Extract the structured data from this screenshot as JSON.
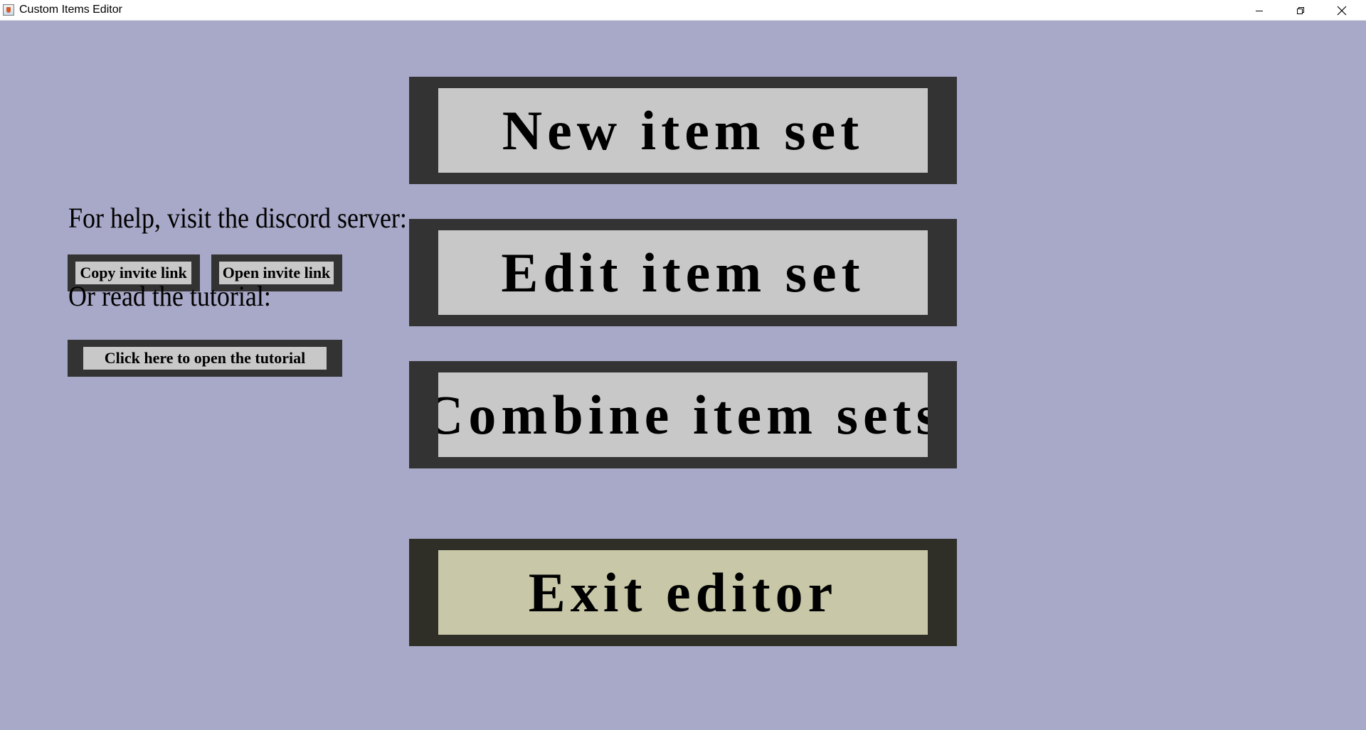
{
  "window": {
    "title": "Custom Items Editor",
    "controls": {
      "minimize_icon": "minimize-icon",
      "restore_icon": "restore-icon",
      "close_icon": "close-icon"
    }
  },
  "help": {
    "discord_text": "For help, visit the discord server:",
    "copy_invite_label": "Copy invite link",
    "open_invite_label": "Open invite link",
    "tutorial_text": "Or read the tutorial:",
    "tutorial_button_label": "Click here to open the tutorial"
  },
  "main_menu": {
    "new_item_set": "New item set",
    "edit_item_set": "Edit item set",
    "combine_item_sets": "Combine item sets",
    "exit_editor": "Exit editor"
  },
  "colors": {
    "background": "#a8a8c8",
    "button_border": "#333333",
    "button_face": "#c8c8c8",
    "exit_border": "#2f2f28",
    "exit_face": "#c8c8a8"
  }
}
